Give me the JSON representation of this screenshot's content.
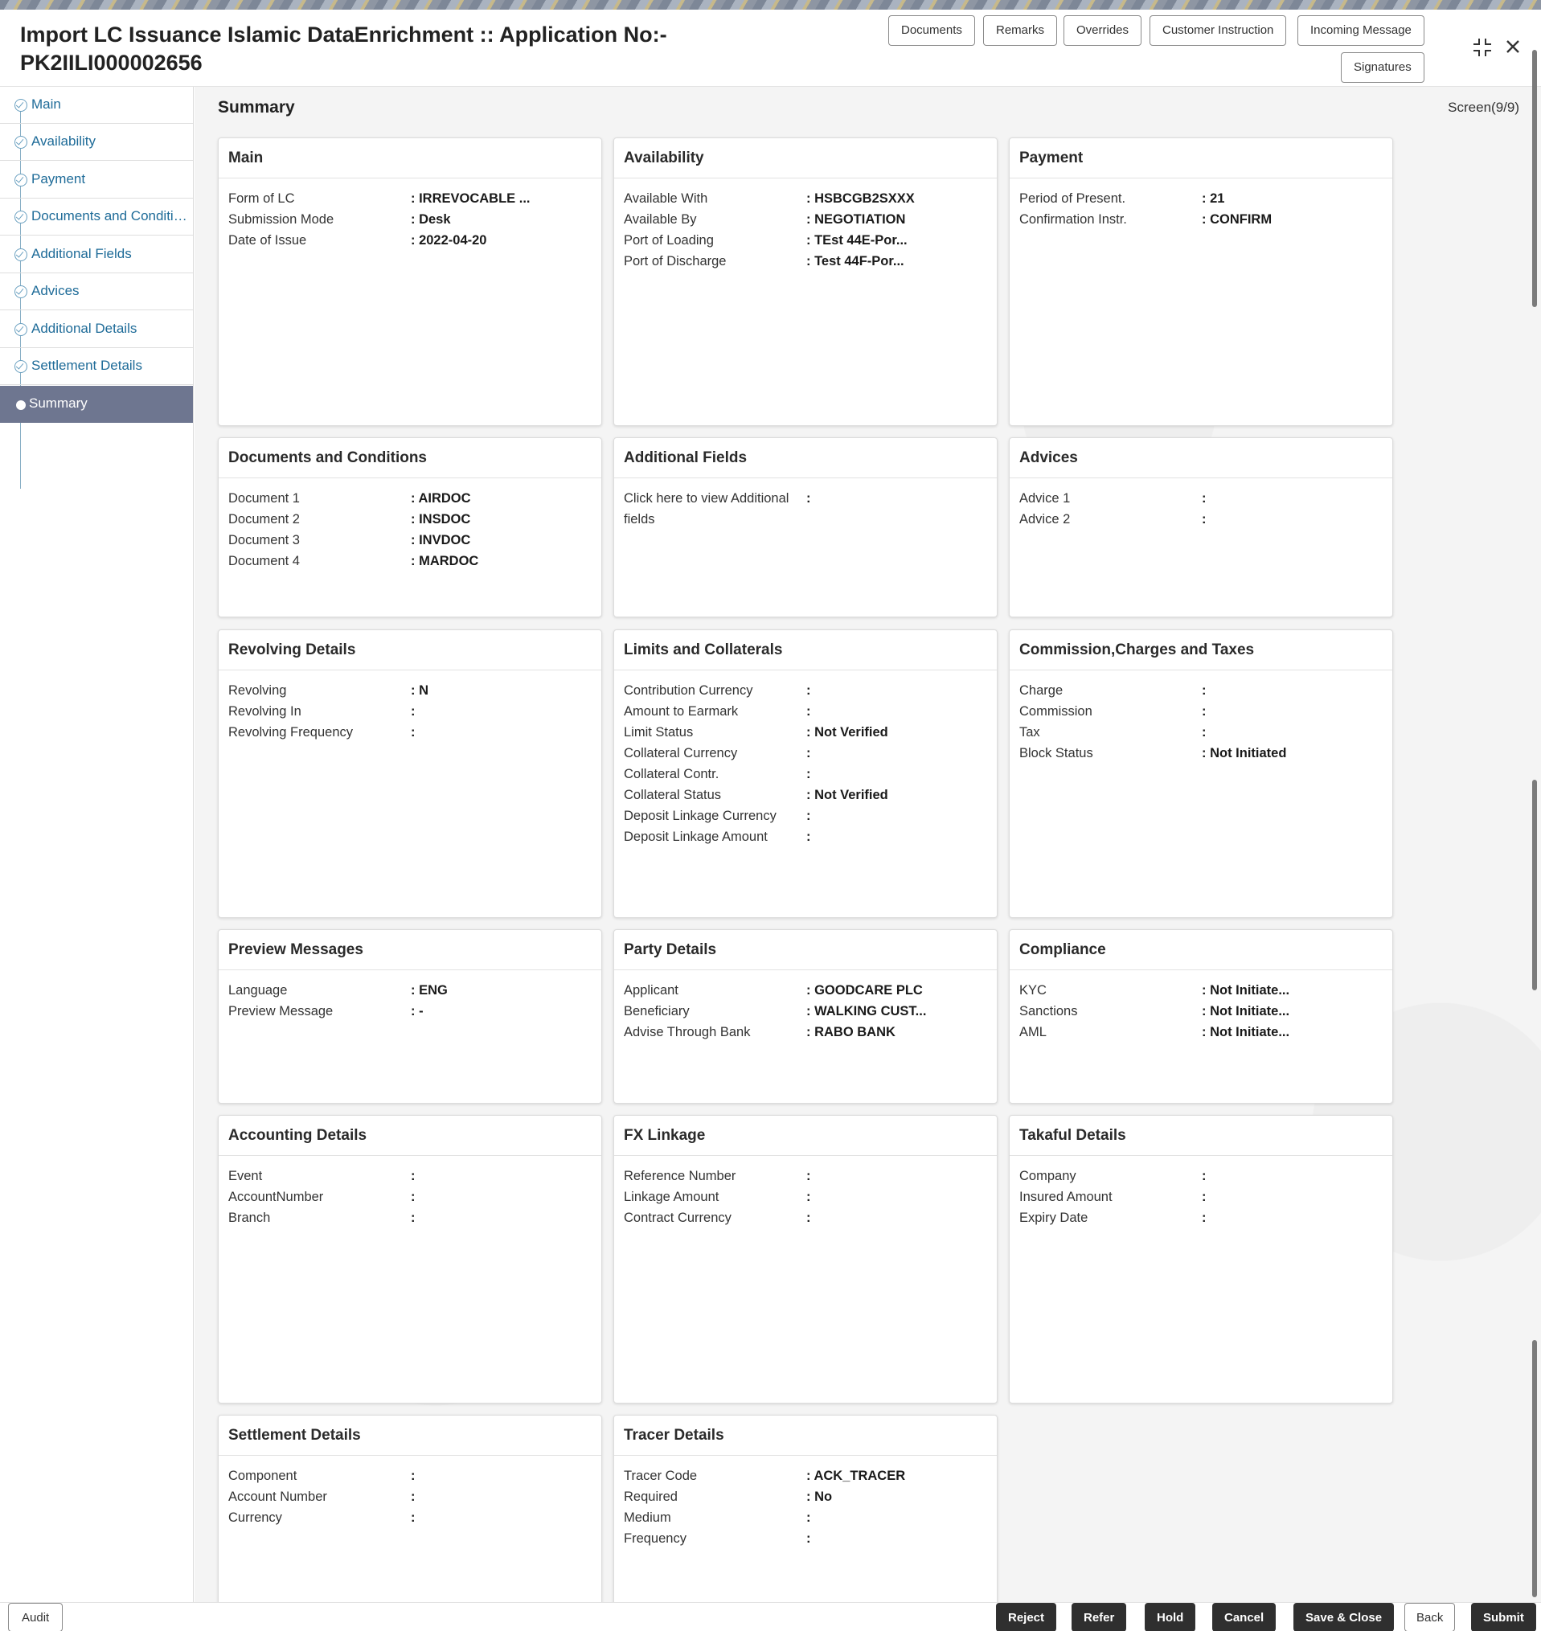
{
  "header": {
    "title_line1": "Import LC Issuance Islamic DataEnrichment :: Application No:-",
    "title_line2": "PK2IILI000002656",
    "buttons": {
      "documents": "Documents",
      "remarks": "Remarks",
      "overrides": "Overrides",
      "customer_instruction": "Customer Instruction",
      "incoming_message": "Incoming Message",
      "signatures": "Signatures"
    },
    "icons": {
      "collapse": "collapse-icon",
      "close": "close-icon"
    }
  },
  "sidebar": {
    "items": [
      {
        "label": "Main"
      },
      {
        "label": "Availability"
      },
      {
        "label": "Payment"
      },
      {
        "label": "Documents and Conditions"
      },
      {
        "label": "Additional Fields"
      },
      {
        "label": "Advices"
      },
      {
        "label": "Additional Details"
      },
      {
        "label": "Settlement Details"
      },
      {
        "label": "Summary"
      }
    ]
  },
  "main": {
    "section_title": "Summary",
    "screen_indicator": "Screen(9/9)"
  },
  "cards": {
    "main": {
      "title": "Main",
      "rows": [
        {
          "label": "Form of LC",
          "value": ": IRREVOCABLE ..."
        },
        {
          "label": "Submission Mode",
          "value": ": Desk"
        },
        {
          "label": "Date of Issue",
          "value": ": 2022-04-20"
        }
      ]
    },
    "availability": {
      "title": "Availability",
      "rows": [
        {
          "label": "Available With",
          "value": ": HSBCGB2SXXX"
        },
        {
          "label": "Available By",
          "value": ": NEGOTIATION"
        },
        {
          "label": "Port of Loading",
          "value": ": TEst 44E-Por..."
        },
        {
          "label": "Port of Discharge",
          "value": ": Test 44F-Por..."
        }
      ]
    },
    "payment": {
      "title": "Payment",
      "rows": [
        {
          "label": "Period of Present.",
          "value": ": 21"
        },
        {
          "label": "Confirmation Instr.",
          "value": ": CONFIRM"
        }
      ]
    },
    "documents": {
      "title": "Documents and Conditions",
      "rows": [
        {
          "label": "Document 1",
          "value": ": AIRDOC"
        },
        {
          "label": "Document 2",
          "value": ": INSDOC"
        },
        {
          "label": "Document 3",
          "value": ": INVDOC"
        },
        {
          "label": "Document 4",
          "value": ": MARDOC"
        }
      ]
    },
    "additional_fields": {
      "title": "Additional Fields",
      "rows": [
        {
          "label": "Click here to view Additional fields",
          "value": ":"
        }
      ]
    },
    "advices": {
      "title": "Advices",
      "rows": [
        {
          "label": "Advice 1",
          "value": ":"
        },
        {
          "label": "Advice 2",
          "value": ":"
        }
      ]
    },
    "revolving": {
      "title": "Revolving Details",
      "rows": [
        {
          "label": "Revolving",
          "value": ": N"
        },
        {
          "label": "Revolving In",
          "value": ":"
        },
        {
          "label": "Revolving Frequency",
          "value": ":"
        }
      ]
    },
    "limits": {
      "title": "Limits and Collaterals",
      "rows": [
        {
          "label": "Contribution Currency",
          "value": ":"
        },
        {
          "label": "Amount to Earmark",
          "value": ":"
        },
        {
          "label": "Limit Status",
          "value": ": Not Verified"
        },
        {
          "label": "Collateral Currency",
          "value": ":"
        },
        {
          "label": "Collateral Contr.",
          "value": ":"
        },
        {
          "label": "Collateral Status",
          "value": ": Not Verified"
        },
        {
          "label": "Deposit Linkage Currency",
          "value": ":"
        },
        {
          "label": "Deposit Linkage Amount",
          "value": ":"
        }
      ]
    },
    "commission": {
      "title": "Commission,Charges and Taxes",
      "rows": [
        {
          "label": "Charge",
          "value": ":"
        },
        {
          "label": "Commission",
          "value": ":"
        },
        {
          "label": "Tax",
          "value": ":"
        },
        {
          "label": "Block Status",
          "value": ": Not Initiated"
        }
      ]
    },
    "preview": {
      "title": "Preview Messages",
      "rows": [
        {
          "label": "Language",
          "value": ": ENG"
        },
        {
          "label": "Preview Message",
          "value": ": -"
        }
      ]
    },
    "party": {
      "title": "Party Details",
      "rows": [
        {
          "label": "Applicant",
          "value": ": GOODCARE PLC"
        },
        {
          "label": "Beneficiary",
          "value": ": WALKING CUST..."
        },
        {
          "label": "Advise Through Bank",
          "value": ": RABO BANK"
        }
      ]
    },
    "compliance": {
      "title": "Compliance",
      "rows": [
        {
          "label": "KYC",
          "value": ": Not Initiate..."
        },
        {
          "label": "Sanctions",
          "value": ": Not Initiate..."
        },
        {
          "label": "AML",
          "value": ": Not Initiate..."
        }
      ]
    },
    "accounting": {
      "title": "Accounting Details",
      "rows": [
        {
          "label": "Event",
          "value": ":"
        },
        {
          "label": "AccountNumber",
          "value": ":"
        },
        {
          "label": "Branch",
          "value": ":"
        }
      ]
    },
    "fx": {
      "title": "FX Linkage",
      "rows": [
        {
          "label": "Reference Number",
          "value": ":"
        },
        {
          "label": "Linkage Amount",
          "value": ":"
        },
        {
          "label": "Contract Currency",
          "value": ":"
        }
      ]
    },
    "takaful": {
      "title": "Takaful Details",
      "rows": [
        {
          "label": "Company",
          "value": ":"
        },
        {
          "label": "Insured Amount",
          "value": ":"
        },
        {
          "label": "Expiry Date",
          "value": ":"
        }
      ]
    },
    "settlement": {
      "title": "Settlement Details",
      "rows": [
        {
          "label": "Component",
          "value": ":"
        },
        {
          "label": "Account Number",
          "value": ":"
        },
        {
          "label": "Currency",
          "value": ":"
        }
      ]
    },
    "tracer": {
      "title": "Tracer Details",
      "rows": [
        {
          "label": "Tracer Code",
          "value": ": ACK_TRACER"
        },
        {
          "label": "Required",
          "value": ": No"
        },
        {
          "label": "Medium",
          "value": ":"
        },
        {
          "label": "Frequency",
          "value": ":"
        }
      ]
    }
  },
  "footer": {
    "audit": "Audit",
    "reject": "Reject",
    "refer": "Refer",
    "hold": "Hold",
    "cancel": "Cancel",
    "save_close": "Save & Close",
    "back": "Back",
    "submit": "Submit"
  }
}
